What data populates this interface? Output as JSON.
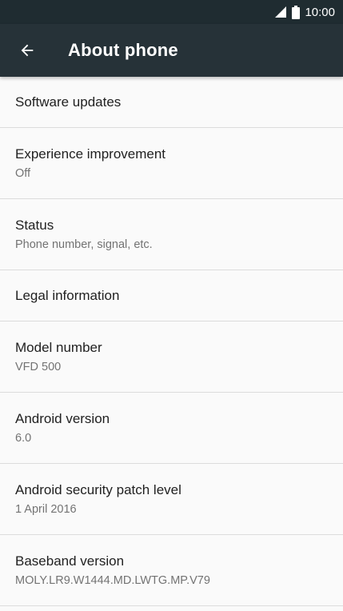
{
  "status_bar": {
    "time": "10:00",
    "icons": [
      "cell-signal-icon",
      "battery-icon"
    ]
  },
  "toolbar": {
    "back_icon": "arrow-left-icon",
    "title": "About phone"
  },
  "colors": {
    "status_bar_bg": "#1f2c31",
    "toolbar_bg": "#263238",
    "list_bg": "#fafafa",
    "divider": "#dcdcdc",
    "title_text": "#212121",
    "summary_text": "#737373"
  },
  "items": [
    {
      "title": "Software updates",
      "summary": ""
    },
    {
      "title": "Experience improvement",
      "summary": "Off"
    },
    {
      "title": "Status",
      "summary": "Phone number, signal, etc."
    },
    {
      "title": "Legal information",
      "summary": ""
    },
    {
      "title": "Model number",
      "summary": "VFD 500"
    },
    {
      "title": "Android version",
      "summary": "6.0"
    },
    {
      "title": "Android security patch level",
      "summary": "1 April 2016"
    },
    {
      "title": "Baseband version",
      "summary": "MOLY.LR9.W1444.MD.LWTG.MP.V79"
    }
  ]
}
